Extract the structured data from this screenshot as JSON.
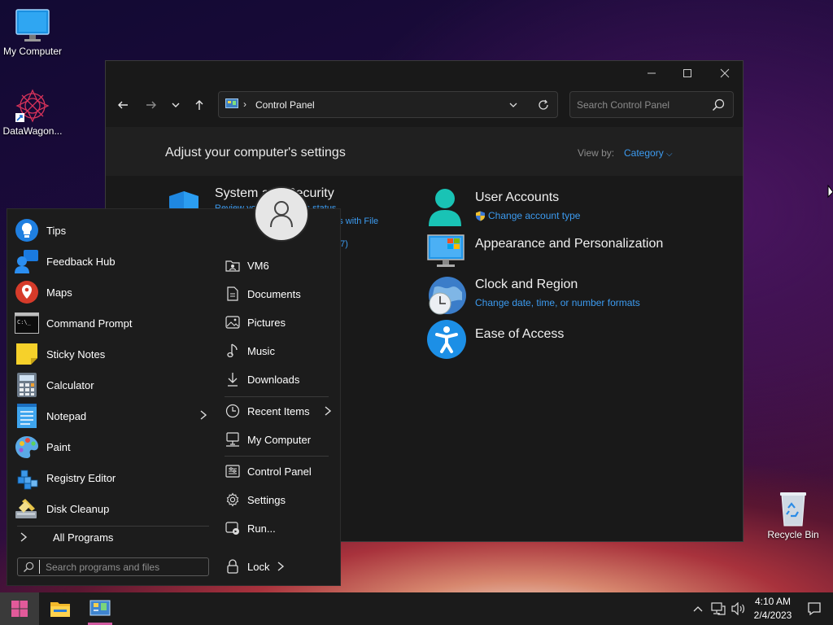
{
  "desktop": {
    "icons": [
      {
        "label": "My Computer"
      },
      {
        "label": "DataWagon..."
      },
      {
        "label": "Recycle Bin"
      }
    ]
  },
  "window": {
    "address_path": "Control Panel",
    "search_placeholder": "Search Control Panel",
    "header_title": "Adjust your computer's settings",
    "view_by_label": "View by:",
    "view_by_value": "Category",
    "categories_left": [
      {
        "title": "System and Security",
        "link1": "Review your computer's status",
        "link2": "Save backup copies of your files with File",
        "link3": "Backup and Restore (Windows 7)"
      }
    ],
    "categories_right": [
      {
        "title": "User Accounts",
        "link": "Change account type"
      },
      {
        "title": "Appearance and Personalization"
      },
      {
        "title": "Clock and Region",
        "link": "Change date, time, or number formats"
      },
      {
        "title": "Ease of Access"
      }
    ]
  },
  "start_menu": {
    "apps": [
      {
        "label": "Tips"
      },
      {
        "label": "Feedback Hub"
      },
      {
        "label": "Maps"
      },
      {
        "label": "Command Prompt"
      },
      {
        "label": "Sticky Notes"
      },
      {
        "label": "Calculator"
      },
      {
        "label": "Notepad"
      },
      {
        "label": "Paint"
      },
      {
        "label": "Registry Editor"
      },
      {
        "label": "Disk Cleanup"
      }
    ],
    "all_programs": "All Programs",
    "search_placeholder": "Search programs and files",
    "places": [
      {
        "label": "VM6"
      },
      {
        "label": "Documents"
      },
      {
        "label": "Pictures"
      },
      {
        "label": "Music"
      },
      {
        "label": "Downloads"
      },
      {
        "label": "Recent Items"
      },
      {
        "label": "My Computer"
      },
      {
        "label": "Control Panel"
      },
      {
        "label": "Settings"
      },
      {
        "label": "Run..."
      }
    ],
    "lock_label": "Lock"
  },
  "taskbar": {
    "time": "4:10 AM",
    "date": "2/4/2023"
  },
  "colors": {
    "accent": "#3c9bf0",
    "window_bg": "#191919",
    "start_bg": "#1c1c1c",
    "taskbar_bg": "#1b1b1b"
  }
}
